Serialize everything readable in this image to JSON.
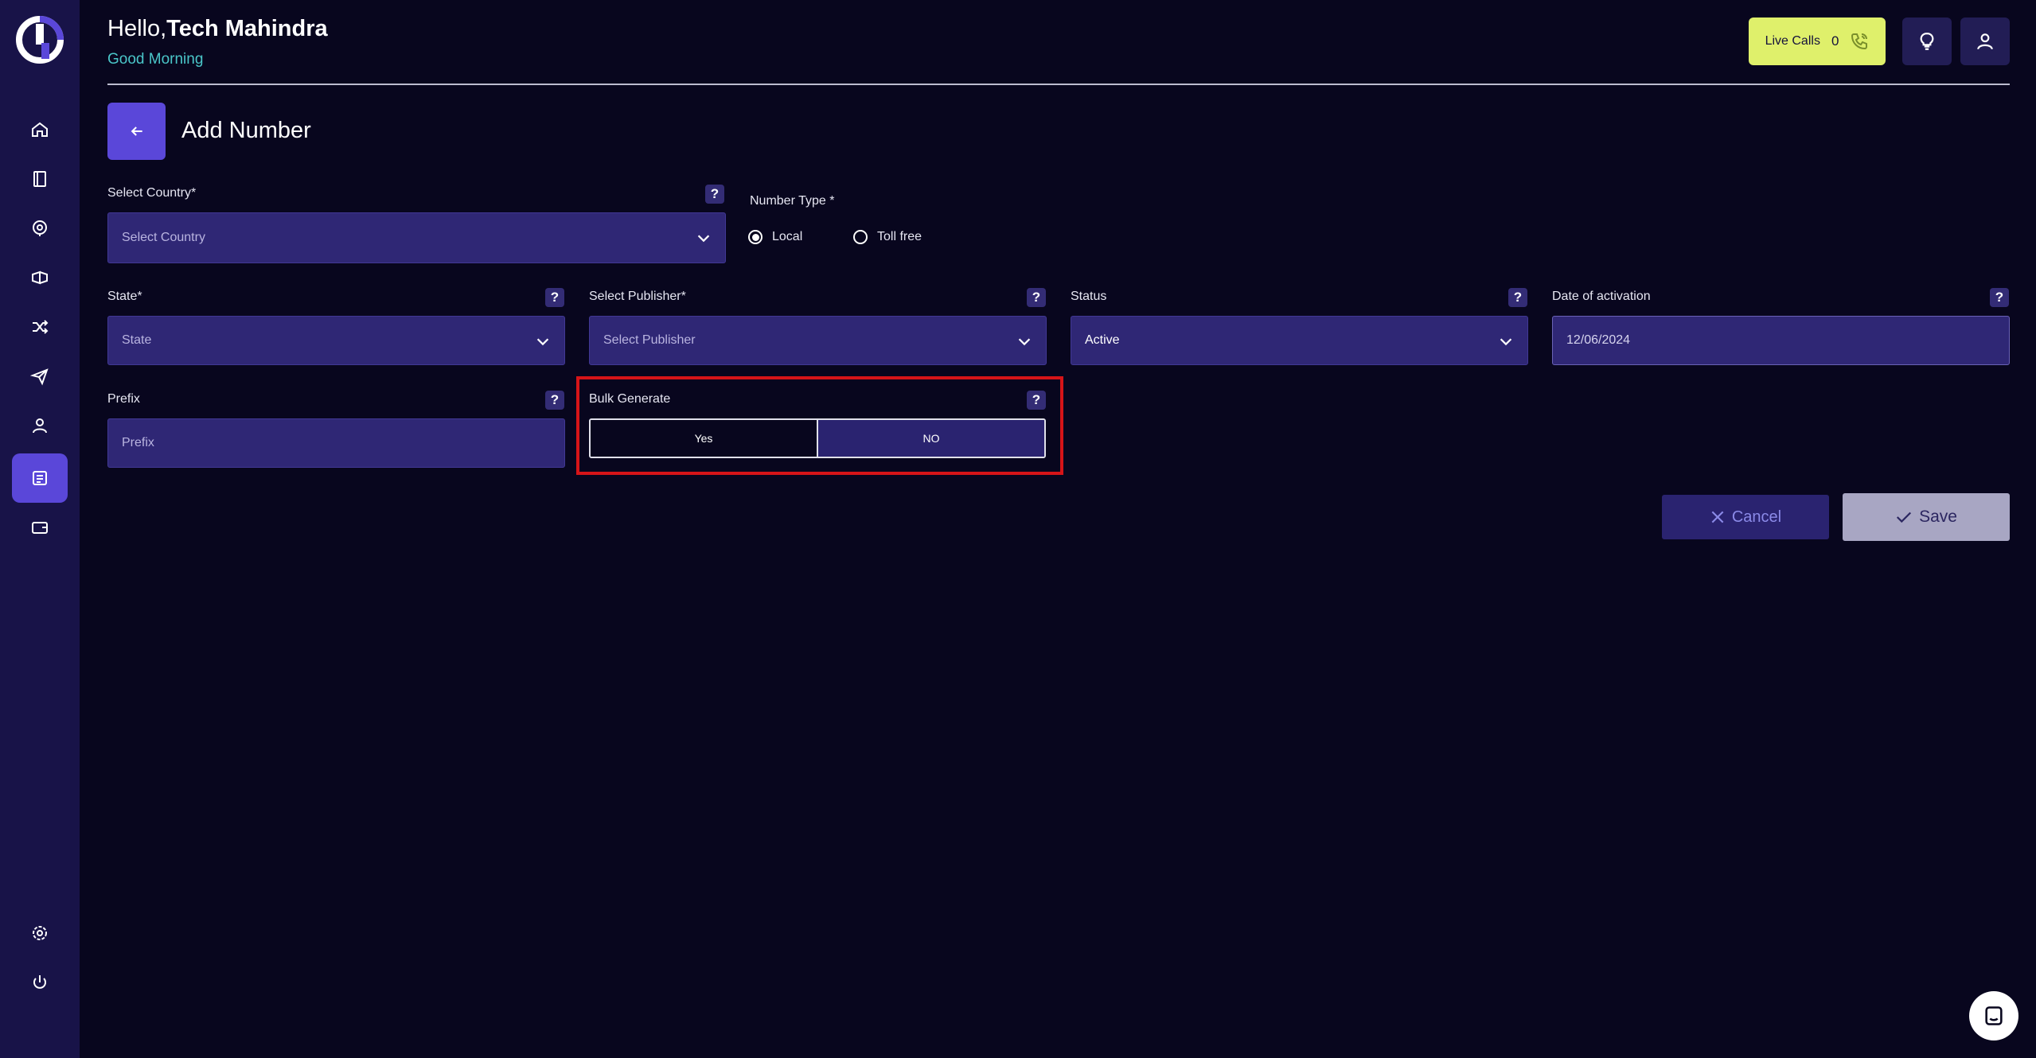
{
  "header": {
    "greeting": "Hello,",
    "user_name": "Tech Mahindra",
    "subtitle": "Good Morning",
    "live_calls_label": "Live Calls",
    "live_calls_count": "0"
  },
  "page": {
    "title": "Add Number"
  },
  "sidebar": {
    "items": [
      {
        "icon": "home-icon"
      },
      {
        "icon": "book-icon"
      },
      {
        "icon": "target-icon"
      },
      {
        "icon": "campaign-icon"
      },
      {
        "icon": "shuffle-icon"
      },
      {
        "icon": "send-icon"
      },
      {
        "icon": "user-icon"
      },
      {
        "icon": "numbers-icon",
        "active": true
      },
      {
        "icon": "wallet-icon"
      }
    ],
    "bottom": [
      {
        "icon": "gear-icon"
      },
      {
        "icon": "power-icon"
      }
    ]
  },
  "form": {
    "country": {
      "label": "Select Country*",
      "placeholder": "Select Country"
    },
    "number_type": {
      "label": "Number Type *",
      "options": [
        "Local",
        "Toll free"
      ],
      "selected": "Local"
    },
    "state": {
      "label": "State*",
      "placeholder": "State"
    },
    "publisher": {
      "label": "Select Publisher*",
      "placeholder": "Select Publisher"
    },
    "status": {
      "label": "Status",
      "value": "Active"
    },
    "activation": {
      "label": "Date of activation",
      "value": "12/06/2024"
    },
    "prefix": {
      "label": "Prefix",
      "placeholder": "Prefix"
    },
    "bulk_generate": {
      "label": "Bulk Generate",
      "yes": "Yes",
      "no": "NO",
      "selected": "NO"
    },
    "help": "?"
  },
  "actions": {
    "cancel": "Cancel",
    "save": "Save"
  },
  "colors": {
    "background": "#08061e",
    "sidebar": "#181348",
    "accent": "#5a47d9",
    "live_calls": "#dff06b",
    "highlight": "#d61418"
  }
}
